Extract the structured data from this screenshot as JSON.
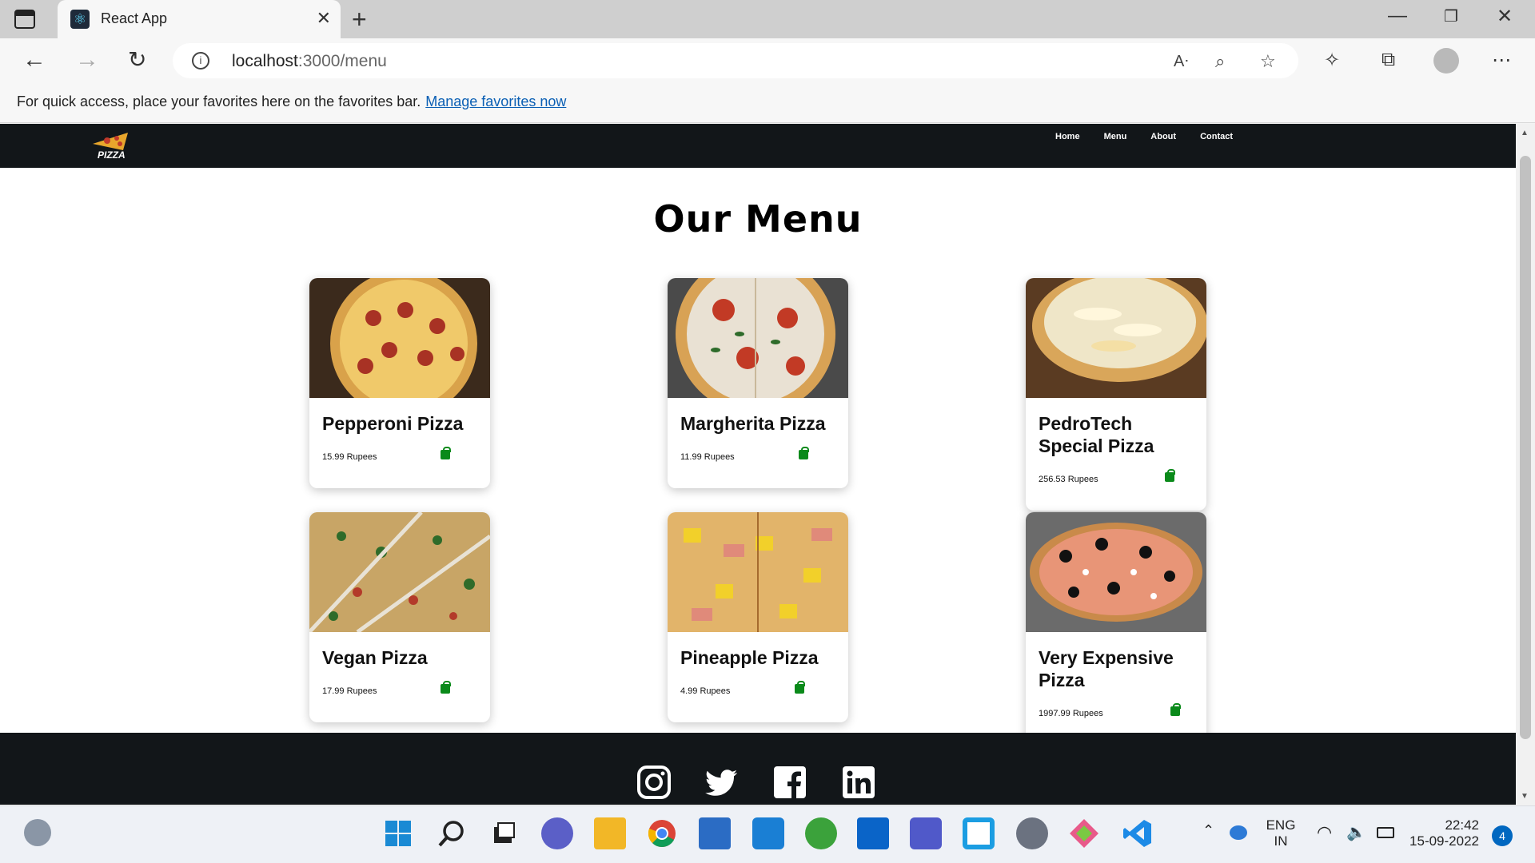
{
  "browser": {
    "tab_title": "React App",
    "url_host": "localhost",
    "url_path": ":3000/menu",
    "favorites_text": "For quick access, place your favorites here on the favorites bar.",
    "favorites_link": "Manage favorites now"
  },
  "site": {
    "nav": [
      "Home",
      "Menu",
      "About",
      "Contact"
    ],
    "logo_text": "PIZZA",
    "page_title": "Our Menu",
    "items": [
      {
        "name": "Pepperoni Pizza",
        "price": "15.99 Rupees"
      },
      {
        "name": "Margherita Pizza",
        "price": "11.99 Rupees"
      },
      {
        "name": "PedroTech Special Pizza",
        "price": "256.53 Rupees"
      },
      {
        "name": "Vegan Pizza",
        "price": "17.99 Rupees"
      },
      {
        "name": "Pineapple Pizza",
        "price": "4.99 Rupees"
      },
      {
        "name": "Very Expensive Pizza",
        "price": "1997.99 Rupees"
      }
    ],
    "social_icons": [
      "instagram-icon",
      "twitter-icon",
      "facebook-icon",
      "linkedin-icon"
    ]
  },
  "taskbar": {
    "lang_top": "ENG",
    "lang_bottom": "IN",
    "time": "22:42",
    "date": "15-09-2022",
    "notifications": "4"
  },
  "colors": {
    "navbar_bg": "#121619",
    "bag_green": "#0a8a1a",
    "link_blue": "#0a5fb4"
  }
}
